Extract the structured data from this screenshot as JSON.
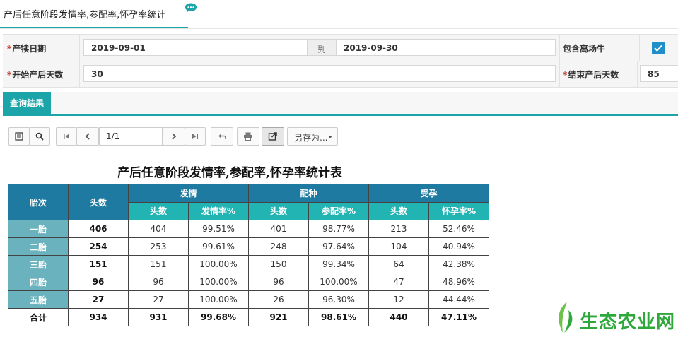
{
  "header": {
    "title": "产后任意阶段发情率,参配率,怀孕率统计",
    "icons": {
      "chat": "chat-bubble-icon"
    }
  },
  "form": {
    "calving_date_label": "产犊日期",
    "date_from": "2019-09-01",
    "to_label": "到",
    "date_to": "2019-09-30",
    "include_left_label": "包含离场牛",
    "include_left_checked": true,
    "start_days_label": "开始产后天数",
    "start_days_value": "30",
    "end_days_label": "结束产后天数",
    "end_days_value": "85",
    "required_mark": "*"
  },
  "tabs": {
    "result": "查询结果"
  },
  "toolbar": {
    "page_indicator": "1/1",
    "save_as_label": "另存为...",
    "icons": [
      "list-icon",
      "search-icon",
      "first-page-icon",
      "prev-page-icon",
      "next-page-icon",
      "last-page-icon",
      "back-icon",
      "print-icon",
      "export-icon"
    ]
  },
  "report": {
    "title": "产后任意阶段发情率,参配率,怀孕率统计表",
    "headers": {
      "parity": "胎次",
      "count": "头数",
      "estrus": "发情",
      "breeding": "配种",
      "pregnancy": "受孕",
      "sub_count": "头数",
      "estrus_rate": "发情率%",
      "breeding_rate": "参配率%",
      "pregnancy_rate": "怀孕率%"
    },
    "rows": [
      {
        "parity": "一胎",
        "count": "406",
        "estrus_n": "404",
        "estrus_rate": "99.51%",
        "breed_n": "401",
        "breed_rate": "98.77%",
        "preg_n": "213",
        "preg_rate": "52.46%"
      },
      {
        "parity": "二胎",
        "count": "254",
        "estrus_n": "253",
        "estrus_rate": "99.61%",
        "breed_n": "248",
        "breed_rate": "97.64%",
        "preg_n": "104",
        "preg_rate": "40.94%"
      },
      {
        "parity": "三胎",
        "count": "151",
        "estrus_n": "151",
        "estrus_rate": "100.00%",
        "breed_n": "150",
        "breed_rate": "99.34%",
        "preg_n": "64",
        "preg_rate": "42.38%"
      },
      {
        "parity": "四胎",
        "count": "96",
        "estrus_n": "96",
        "estrus_rate": "100.00%",
        "breed_n": "96",
        "breed_rate": "100.00%",
        "preg_n": "47",
        "preg_rate": "48.96%"
      },
      {
        "parity": "五胎",
        "count": "27",
        "estrus_n": "27",
        "estrus_rate": "100.00%",
        "breed_n": "26",
        "breed_rate": "96.30%",
        "preg_n": "12",
        "preg_rate": "44.44%"
      }
    ],
    "total": {
      "parity": "合计",
      "count": "934",
      "estrus_n": "931",
      "estrus_rate": "99.68%",
      "breed_n": "921",
      "breed_rate": "98.61%",
      "preg_n": "440",
      "preg_rate": "47.11%"
    }
  },
  "watermark": {
    "text": "生态农业网"
  },
  "colors": {
    "accent": "#1ba5a9",
    "header_dark": "#1e7aa0",
    "header_teal": "#22b3b3",
    "row_head": "#6ab2bd",
    "checkbox": "#1f8ec9",
    "watermark": "#2ea83a"
  }
}
